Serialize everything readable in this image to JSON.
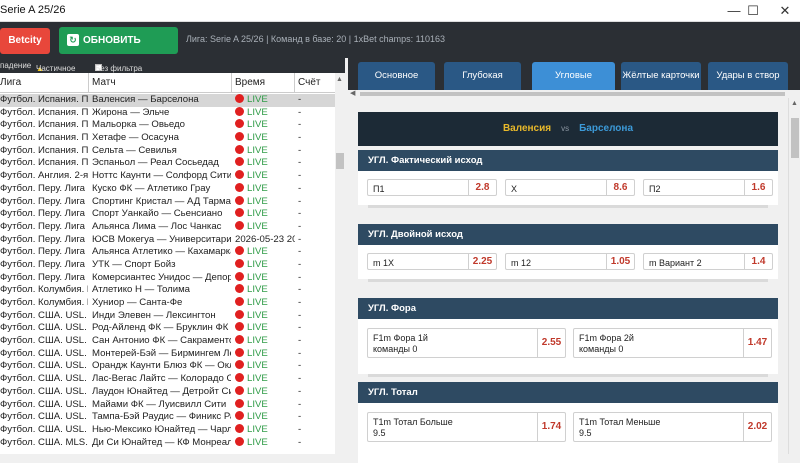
{
  "window": {
    "title": "Serie A 25/26",
    "minimize": "—",
    "maximize": "☐",
    "close": "✕"
  },
  "toolbar": {
    "betcity_label": "Betcity",
    "refresh_label": "ОБНОВИТЬ СПИСОК",
    "info": "Лига: Serie A 25/26  |  Команд в базе: 20  |  1xBet champs: 110163"
  },
  "filters": {
    "f1": "падение",
    "f2": "Частичное",
    "f3": "Без фильтра"
  },
  "table": {
    "headers": {
      "league": "Лига",
      "match": "Матч",
      "time": "Время",
      "score": "Счёт"
    },
    "rows": [
      {
        "league": "Футбол. Испания. Пр...",
        "match": "Валенсия — Барселона",
        "time": "LIVE",
        "score": "-"
      },
      {
        "league": "Футбол. Испания. Пр...",
        "match": "Жирона — Эльче",
        "time": "LIVE",
        "score": "-"
      },
      {
        "league": "Футбол. Испания. Пр...",
        "match": "Мальорка — Овьедо",
        "time": "LIVE",
        "score": "-"
      },
      {
        "league": "Футбол. Испания. Пр...",
        "match": "Хетафе — Осасуна",
        "time": "LIVE",
        "score": "-"
      },
      {
        "league": "Футбол. Испания. Пр...",
        "match": "Сельта — Севилья",
        "time": "LIVE",
        "score": "-"
      },
      {
        "league": "Футбол. Испания. Пр...",
        "match": "Эспаньол — Реал Сосьедад",
        "time": "LIVE",
        "score": "-"
      },
      {
        "league": "Футбол. Англия. 2-я л...",
        "match": "Ноттс Каунти — Солфорд Сити",
        "time": "LIVE",
        "score": "-"
      },
      {
        "league": "Футбол. Перу. Лига 1. ...",
        "match": "Куско ФК — Атлетико Грау",
        "time": "LIVE",
        "score": "-"
      },
      {
        "league": "Футбол. Перу. Лига 1. ...",
        "match": "Спортинг Кристал — АД Тарма",
        "time": "LIVE",
        "score": "-"
      },
      {
        "league": "Футбол. Перу. Лига 1. ...",
        "match": "Спорт Уанкайо — Сьенсиано",
        "time": "LIVE",
        "score": "-"
      },
      {
        "league": "Футбол. Перу. Лига 1. ...",
        "match": "Альянса Лима — Лос Чанкас",
        "time": "LIVE",
        "score": "-"
      },
      {
        "league": "Футбол. Перу. Лига 1. ...",
        "match": "ЮСВ Мокегуа — Университарио ...",
        "time": "2026-05-23 20...",
        "score": "-",
        "nolive": true
      },
      {
        "league": "Футбол. Перу. Лига 1. ...",
        "match": "Альянса Атлетико — Кахамарка",
        "time": "LIVE",
        "score": "-"
      },
      {
        "league": "Футбол. Перу. Лига 1. ...",
        "match": "УТК — Спорт Бойз",
        "time": "LIVE",
        "score": "-"
      },
      {
        "league": "Футбол. Перу. Лига 1. ...",
        "match": "Комерсиантес Унидос — Депорт...",
        "time": "LIVE",
        "score": "-"
      },
      {
        "league": "Футбол. Колумбия. П...",
        "match": "Атлетико Н — Толима",
        "time": "LIVE",
        "score": "-"
      },
      {
        "league": "Футбол. Колумбия. П...",
        "match": "Хуниор — Санта-Фе",
        "time": "LIVE",
        "score": "-"
      },
      {
        "league": "Футбол. США. USL. Че...",
        "match": "Инди Элевен — Лексингтон",
        "time": "LIVE",
        "score": "-"
      },
      {
        "league": "Футбол. США. USL. Че...",
        "match": "Род-Айленд ФК — Бруклин ФК",
        "time": "LIVE",
        "score": "-"
      },
      {
        "league": "Футбол. США. USL. Че...",
        "match": "Сан Антонио ФК — Сакраменто ...",
        "time": "LIVE",
        "score": "-"
      },
      {
        "league": "Футбол. США. USL. Че...",
        "match": "Монтерей-Бэй — Бирмингем Ле...",
        "time": "LIVE",
        "score": "-"
      },
      {
        "league": "Футбол. США. USL. Че...",
        "match": "Орандж Каунти Блюз ФК — Окле...",
        "time": "LIVE",
        "score": "-"
      },
      {
        "league": "Футбол. США. USL. Че...",
        "match": "Лас-Вегас Лайтс — Колорадо Сп...",
        "time": "LIVE",
        "score": "-"
      },
      {
        "league": "Футбол. США. USL. Че...",
        "match": "Лаудон Юнайтед — Детройт Сити",
        "time": "LIVE",
        "score": "-"
      },
      {
        "league": "Футбол. США. USL. Че...",
        "match": "Майами ФК — Луисвилл Сити",
        "time": "LIVE",
        "score": "-"
      },
      {
        "league": "Футбол. США. USL. Че...",
        "match": "Тампа-Бэй Раудис — Финикс Рай...",
        "time": "LIVE",
        "score": "-"
      },
      {
        "league": "Футбол. США. USL. Че...",
        "match": "Нью-Мексико Юнайтед — Чарлс...",
        "time": "LIVE",
        "score": "-"
      },
      {
        "league": "Футбол. США. MLS. Ре...",
        "match": "Ди Си Юнайтед — КФ Монреаль",
        "time": "LIVE",
        "score": "-"
      }
    ]
  },
  "tabs": [
    {
      "label": "Основное"
    },
    {
      "label": "Глубокая роспись"
    },
    {
      "label": "Угловые",
      "active": true
    },
    {
      "label": "Жёлтые карточки"
    },
    {
      "label": "Удары в створ"
    }
  ],
  "match": {
    "home": "Валенсия",
    "vs": "vs",
    "away": "Барселона"
  },
  "sections": [
    {
      "title": "УГЛ. Фактический исход",
      "odds": [
        {
          "label": "П1",
          "value": "2.8"
        },
        {
          "label": "X",
          "value": "8.6"
        },
        {
          "label": "П2",
          "value": "1.6"
        }
      ]
    },
    {
      "title": "УГЛ. Двойной исход",
      "odds": [
        {
          "label": "m 1X",
          "value": "2.25"
        },
        {
          "label": "m 12",
          "value": "1.05"
        },
        {
          "label": "m Вариант 2",
          "value": "1.4"
        }
      ]
    },
    {
      "title": "УГЛ. Фора",
      "odds": [
        {
          "label": "F1m Фора 1й\nкоманды 0",
          "value": "2.55"
        },
        {
          "label": "F1m Фора 2й\nкоманды 0",
          "value": "1.47"
        }
      ]
    },
    {
      "title": "УГЛ. Тотал",
      "odds": [
        {
          "label": "T1m Тотал Больше\n9.5",
          "value": "1.74"
        },
        {
          "label": "T1m Тотал Меньше\n9.5",
          "value": "2.02"
        }
      ]
    }
  ],
  "colors": {
    "accent": "#3d8fd6",
    "live": "#2e9b46",
    "odd_value": "#c0392b",
    "home": "#e9b92a",
    "away": "#3c9ad8"
  }
}
